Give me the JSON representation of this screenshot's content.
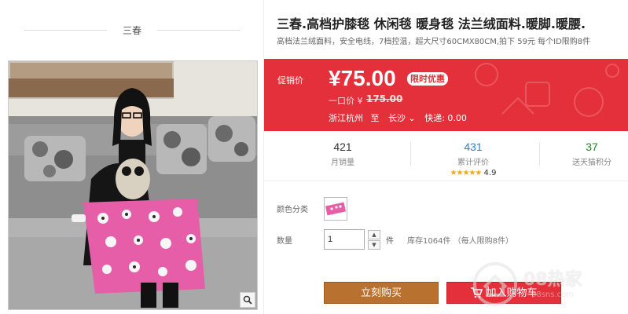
{
  "shop": {
    "name": "三春"
  },
  "product": {
    "title": "三春.高档护膝毯 休闲毯 暖身毯 法兰绒面料.暖脚.暖腰.",
    "subtitle": "高档法兰绒面料，安全电线，7档控温，超大尺寸60CMX80CM,拍下 59元 每个ID限购8件"
  },
  "price": {
    "promo_label": "促销价",
    "promo_price": "¥75.00",
    "promo_badge": "限时优惠",
    "original_label": "一口价 ¥",
    "original_price": "175.00",
    "ship_from": "浙江杭州",
    "ship_to_label": "至",
    "ship_to": "长沙",
    "express": "快递: 0.00"
  },
  "stats": {
    "monthly_sales": {
      "value": "421",
      "label": "月销量"
    },
    "reviews": {
      "value": "431",
      "label": "累计评价",
      "rating": "4.9",
      "stars": "★★★★★"
    },
    "points": {
      "value": "37",
      "label": "送天猫积分"
    }
  },
  "sku": {
    "color_label": "颜色分类"
  },
  "quantity": {
    "label": "数量",
    "value": "1",
    "unit": "件",
    "stock_text": "库存1064件 （每人限购8件）"
  },
  "actions": {
    "buy_now": "立刻购买",
    "add_to_cart": "加入购物车"
  },
  "watermark": {
    "text": "08热家",
    "sub": "08sns.com"
  },
  "colors": {
    "accent_red": "#e3303a",
    "buy_brown": "#b9712f",
    "review_blue": "#2a7fd6",
    "points_green": "#1b8a1b",
    "star_orange": "#f2a91f"
  }
}
